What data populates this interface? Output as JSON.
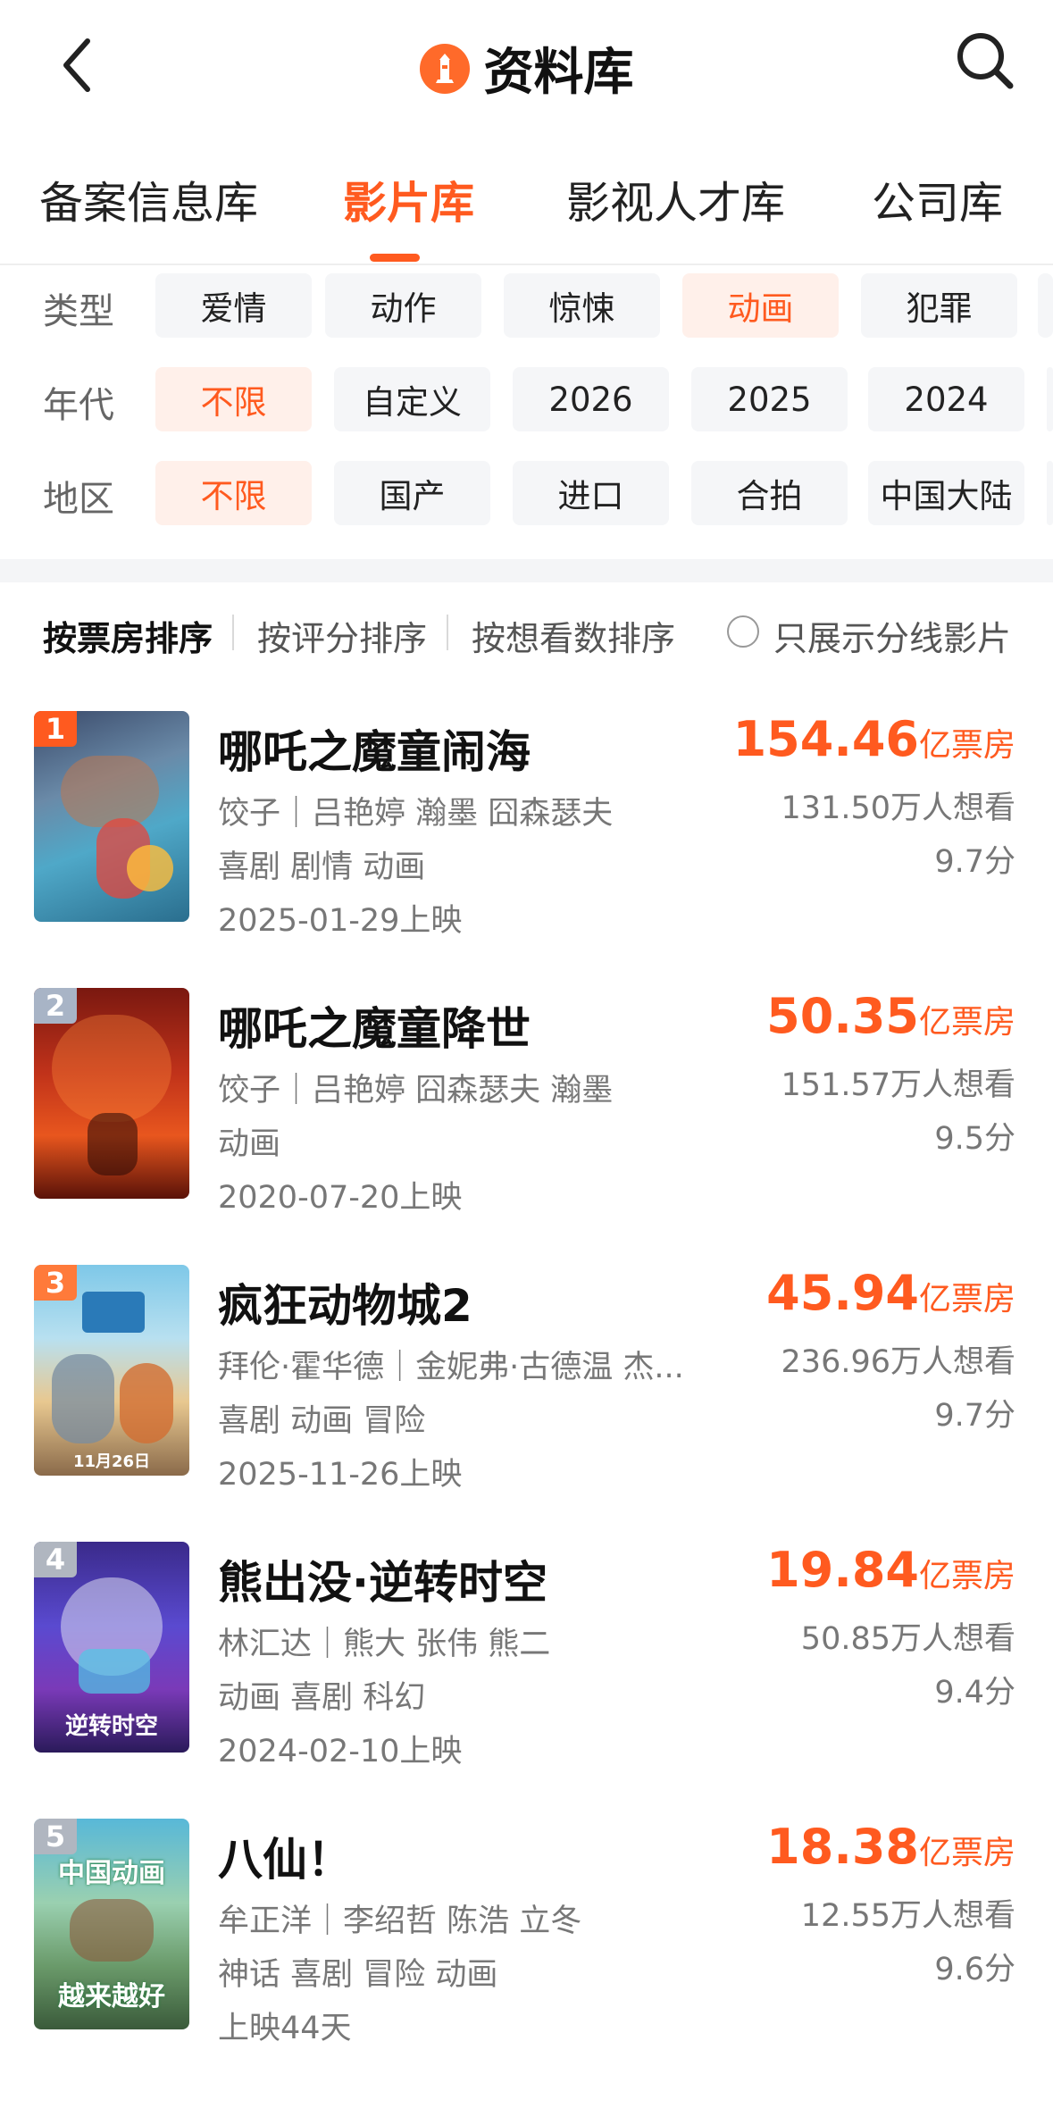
{
  "header": {
    "title": "资料库",
    "back_icon": "back-chevron-icon",
    "search_icon": "search-icon",
    "logo_icon": "lighthouse-logo-icon"
  },
  "tabs": [
    {
      "label": "备案信息库"
    },
    {
      "label": "影片库",
      "active": true
    },
    {
      "label": "影视人才库"
    },
    {
      "label": "公司库"
    }
  ],
  "filters": {
    "type": {
      "label": "类型",
      "options": [
        "爱情",
        "动作",
        "惊悚",
        "动画",
        "犯罪"
      ],
      "selected": "动画"
    },
    "era": {
      "label": "年代",
      "options": [
        "不限",
        "自定义",
        "2026",
        "2025",
        "2024"
      ],
      "selected": "不限"
    },
    "region": {
      "label": "地区",
      "options": [
        "不限",
        "国产",
        "进口",
        "合拍",
        "中国大陆"
      ],
      "selected": "不限"
    }
  },
  "sort": {
    "options": [
      "按票房排序",
      "按评分排序",
      "按想看数排序"
    ],
    "selected": "按票房排序",
    "split_only_label": "只展示分线影片"
  },
  "accent_color": "#ff5a1f",
  "films": [
    {
      "rank": "1",
      "title": "哪吒之魔童闹海",
      "cast": "饺子｜吕艳婷 瀚墨 囧森瑟夫",
      "genres": "喜剧 剧情 动画",
      "release": "2025-01-29上映",
      "box_office": "154.46",
      "box_unit": "亿票房",
      "want": "131.50万人想看",
      "score": "9.7分"
    },
    {
      "rank": "2",
      "title": "哪吒之魔童降世",
      "cast": "饺子｜吕艳婷 囧森瑟夫 瀚墨",
      "genres": "动画",
      "release": "2020-07-20上映",
      "box_office": "50.35",
      "box_unit": "亿票房",
      "want": "151.57万人想看",
      "score": "9.5分"
    },
    {
      "rank": "3",
      "title": "疯狂动物城2",
      "cast": "拜伦·霍华德｜金妮弗·古德温 杰...",
      "genres": "喜剧 动画 冒险",
      "release": "2025-11-26上映",
      "box_office": "45.94",
      "box_unit": "亿票房",
      "want": "236.96万人想看",
      "score": "9.7分",
      "poster_text": "11月26日"
    },
    {
      "rank": "4",
      "title": "熊出没·逆转时空",
      "cast": "林汇达｜熊大 张伟 熊二",
      "genres": "动画 喜剧 科幻",
      "release": "2024-02-10上映",
      "box_office": "19.84",
      "box_unit": "亿票房",
      "want": "50.85万人想看",
      "score": "9.4分",
      "poster_text": "逆转时空"
    },
    {
      "rank": "5",
      "title": "八仙！",
      "cast": "牟正洋｜李绍哲 陈浩 立冬",
      "genres": "神话 喜剧 冒险 动画",
      "release": "上映44天",
      "box_office": "18.38",
      "box_unit": "亿票房",
      "want": "12.55万人想看",
      "score": "9.6分",
      "poster_text_top": "中国动画",
      "poster_text_bottom": "越来越好"
    }
  ]
}
